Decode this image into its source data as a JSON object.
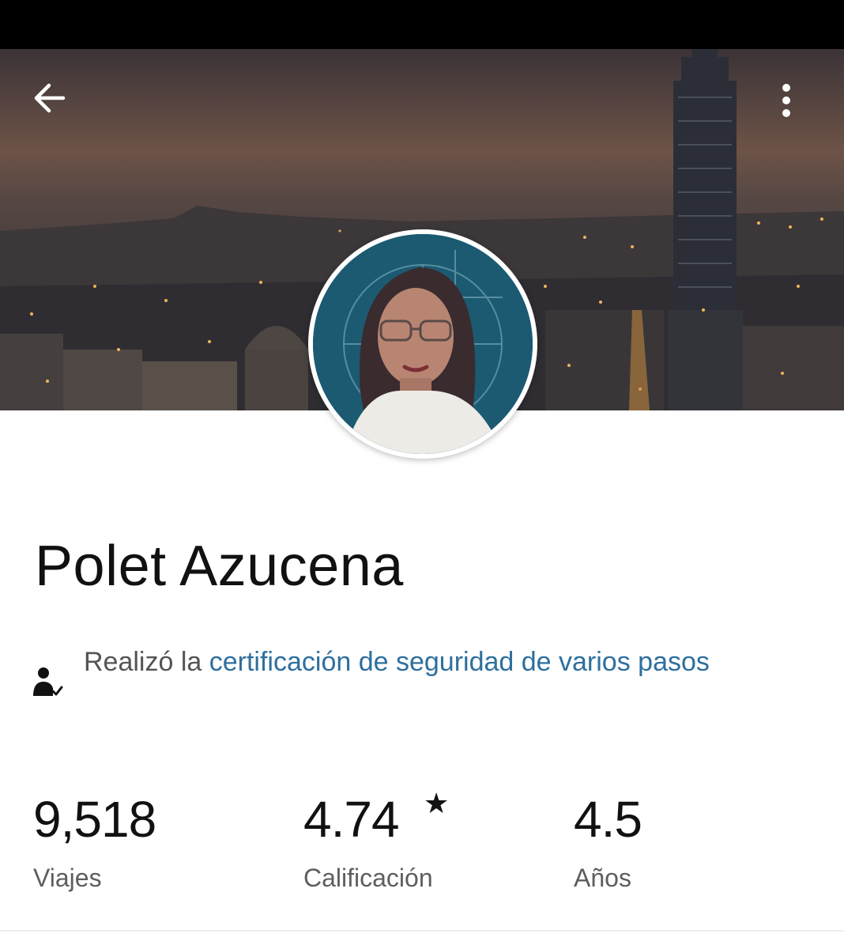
{
  "colors": {
    "link": "#2e6f9e",
    "text_primary": "#111111",
    "text_secondary": "#5e5e5e",
    "status_bar": "#000000"
  },
  "header": {
    "back_icon": "arrow-left-icon",
    "menu_icon": "more-vertical-icon"
  },
  "profile": {
    "name": "Polet Azucena",
    "certification": {
      "prefix": "Realizó la ",
      "link_text": "certificación de seguridad de varios pasos",
      "icon": "verified-user-icon"
    }
  },
  "stats": [
    {
      "value": "9,518",
      "label": "Viajes"
    },
    {
      "value": "4.74",
      "label": "Calificación",
      "suffix_icon": "star-icon",
      "suffix": "★"
    },
    {
      "value": "4.5",
      "label": "Años"
    }
  ]
}
